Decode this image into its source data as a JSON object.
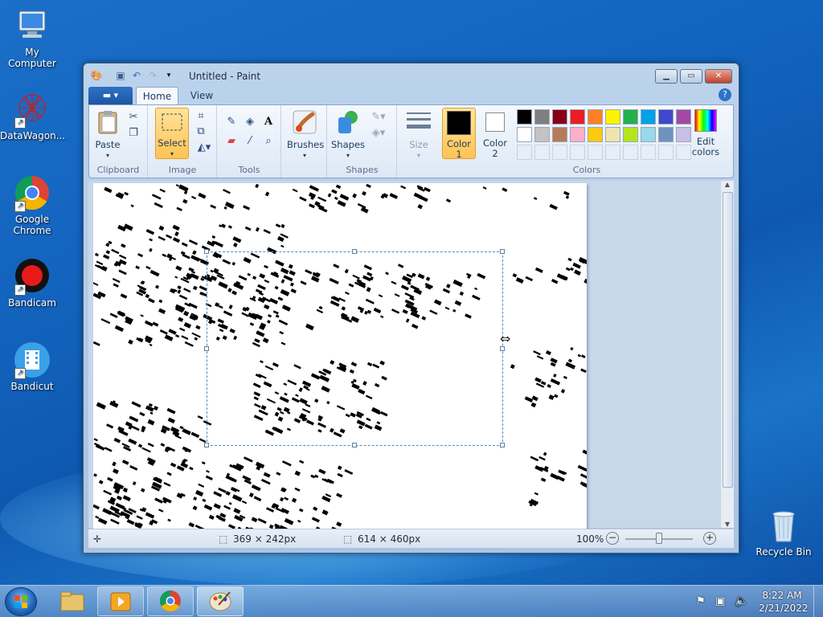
{
  "desktop": {
    "icons": [
      {
        "label": "My Computer"
      },
      {
        "label": "DataWagon..."
      },
      {
        "label": "Google Chrome"
      },
      {
        "label": "Bandicam"
      },
      {
        "label": "Bandicut"
      },
      {
        "label": "Recycle Bin"
      }
    ]
  },
  "window": {
    "title": "Untitled - Paint",
    "tabs": [
      "Home",
      "View"
    ],
    "ribbon": {
      "clipboard": {
        "paste": "Paste",
        "group": "Clipboard"
      },
      "image": {
        "select": "Select",
        "group": "Image"
      },
      "tools": {
        "group": "Tools"
      },
      "brushes": {
        "label": "Brushes"
      },
      "shapes": {
        "label": "Shapes",
        "group": "Shapes"
      },
      "size": {
        "label": "Size"
      },
      "color1": {
        "line1": "Color",
        "line2": "1"
      },
      "color2": {
        "line1": "Color",
        "line2": "2"
      },
      "colors_group": "Colors",
      "edit_colors": {
        "line1": "Edit",
        "line2": "colors"
      }
    },
    "palette_row1": [
      "#000000",
      "#7f7f7f",
      "#880015",
      "#ed1c24",
      "#ff7f27",
      "#fff200",
      "#22b14c",
      "#00a2e8",
      "#3f48cc",
      "#a349a4"
    ],
    "palette_row2": [
      "#ffffff",
      "#c3c3c3",
      "#b97a57",
      "#ffaec9",
      "#ffc90e",
      "#efe4b0",
      "#b5e61d",
      "#99d9ea",
      "#7092be",
      "#c8bfe7"
    ],
    "color1_value": "#000000",
    "color2_value": "#ffffff",
    "status": {
      "selection_size": "369 × 242px",
      "image_size": "614 × 460px",
      "zoom": "100%"
    }
  },
  "taskbar": {
    "time": "8:22 AM",
    "date": "2/21/2022"
  }
}
